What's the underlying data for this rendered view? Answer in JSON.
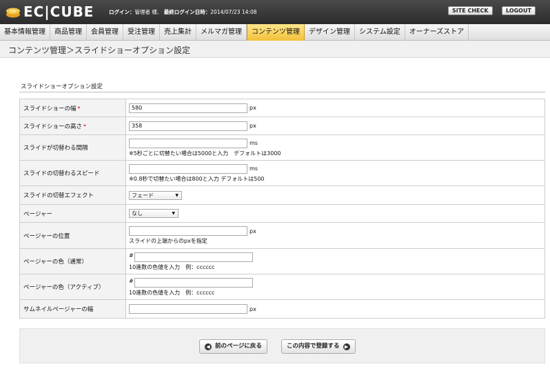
{
  "header": {
    "logo_text": "EC|CUBE",
    "login_label": "ログイン：",
    "login_user": "管理者 様、",
    "last_login_label": "最終ログイン日時：",
    "last_login_value": "2014/07/23 14:08",
    "site_check_label": "SITE CHECK",
    "logout_label": "LOGOUT"
  },
  "nav": {
    "items": [
      {
        "label": "基本情報管理"
      },
      {
        "label": "商品管理"
      },
      {
        "label": "会員管理"
      },
      {
        "label": "受注管理"
      },
      {
        "label": "売上集計"
      },
      {
        "label": "メルマガ管理"
      },
      {
        "label": "コンテンツ管理",
        "active": true
      },
      {
        "label": "デザイン管理"
      },
      {
        "label": "システム設定"
      },
      {
        "label": "オーナーズストア"
      }
    ]
  },
  "page": {
    "title": "コンテンツ管理＞スライドショーオプション設定",
    "section_title": "スライドショーオプション設定"
  },
  "form": {
    "width": {
      "label": "スライドショーの幅",
      "required": "*",
      "value": "580",
      "unit": "px"
    },
    "height": {
      "label": "スライドショーの高さ",
      "required": "*",
      "value": "358",
      "unit": "px"
    },
    "interval": {
      "label": "スライドが切替わる間隔",
      "value": "",
      "unit": "ms",
      "note": "※5秒ごとに切替たい場合は5000と入力　デフォルトは3000"
    },
    "speed": {
      "label": "スライドの切替わるスピード",
      "value": "",
      "unit": "ms",
      "note": "※0.8秒で切替たい場合は800と入力 デフォルトは500"
    },
    "effect": {
      "label": "スライドの切替エフェクト",
      "selected": "フェード"
    },
    "pager": {
      "label": "ページャー",
      "selected": "なし"
    },
    "pager_position": {
      "label": "ページャーの位置",
      "value": "",
      "unit": "px",
      "note": "スライドの上端からのpxを指定"
    },
    "pager_color": {
      "label": "ページャーの色（通常）",
      "hash": "#",
      "value": "",
      "note": "10進数の色値を入力　例：cccccc"
    },
    "pager_color_active": {
      "label": "ページャーの色（アクティブ）",
      "hash": "#",
      "value": "",
      "note": "10進数の色値を入力　例：cccccc"
    },
    "thumb_width": {
      "label": "サムネイルページャーの幅",
      "value": "",
      "unit": "px"
    }
  },
  "footer": {
    "back_label": "前のページに戻る",
    "register_label": "この内容で登録する"
  },
  "icons": {
    "back": "arrow-left-circle-icon",
    "register": "arrow-right-circle-icon"
  },
  "colors": {
    "required": "#cc0000",
    "active_tab": "#f2c03a",
    "header_bg": "#2b2b2b"
  }
}
